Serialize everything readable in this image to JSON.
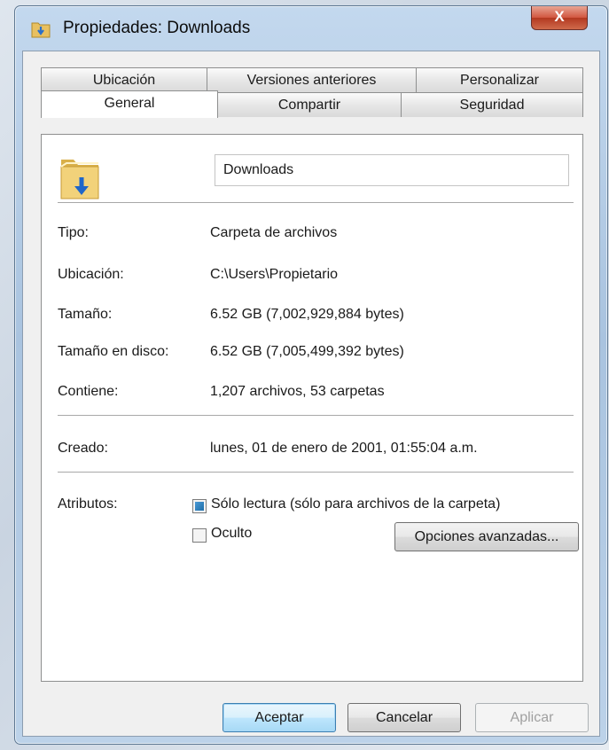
{
  "window": {
    "title": "Propiedades: Downloads",
    "close_label": "X"
  },
  "tabs": {
    "row1": [
      {
        "label": "Ubicación"
      },
      {
        "label": "Versiones anteriores"
      },
      {
        "label": "Personalizar"
      }
    ],
    "row2": [
      {
        "label": "General",
        "active": true
      },
      {
        "label": "Compartir"
      },
      {
        "label": "Seguridad"
      }
    ]
  },
  "general": {
    "folder_name": "Downloads",
    "tipo_label": "Tipo:",
    "tipo_value": "Carpeta de archivos",
    "ubicacion_label": "Ubicación:",
    "ubicacion_value": "C:\\Users\\Propietario",
    "tamano_label": "Tamaño:",
    "tamano_value": "6.52 GB (7,002,929,884 bytes)",
    "tamano_disco_label": "Tamaño en disco:",
    "tamano_disco_value": "6.52 GB (7,005,499,392 bytes)",
    "contiene_label": "Contiene:",
    "contiene_value": "1,207 archivos, 53 carpetas",
    "creado_label": "Creado:",
    "creado_value": "lunes, 01 de enero de 2001, 01:55:04 a.m.",
    "atributos_label": "Atributos:",
    "solo_lectura_label": "Sólo lectura (sólo para archivos de la carpeta)",
    "solo_lectura_state": "indeterminate",
    "oculto_label": "Oculto",
    "oculto_state": "unchecked",
    "opciones_avanzadas_label": "Opciones avanzadas..."
  },
  "buttons": {
    "aceptar": "Aceptar",
    "cancelar": "Cancelar",
    "aplicar": "Aplicar"
  },
  "icons": {
    "title_icon": "folder-download-icon",
    "big_icon": "folder-download-icon"
  }
}
